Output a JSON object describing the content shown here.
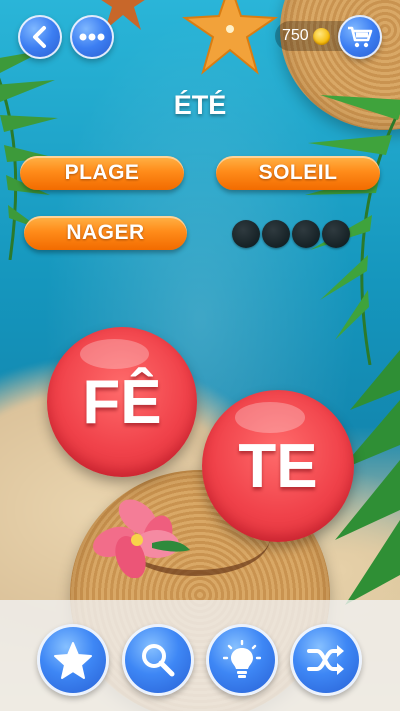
{
  "header": {
    "back_icon": "chevron-left-icon",
    "menu_icon": "more-dots-icon",
    "coins": "750",
    "coin_icon": "coin-icon",
    "cart_icon": "shopping-cart-icon"
  },
  "puzzle": {
    "category": "ÉTÉ",
    "found_words": [
      {
        "label": "PLAGE"
      },
      {
        "label": "SOLEIL"
      },
      {
        "label": "NAGER"
      }
    ],
    "hidden_word_letter_count": 4
  },
  "letter_bubbles": [
    {
      "label": "FÊ"
    },
    {
      "label": "TE"
    }
  ],
  "toolbar": {
    "items": [
      {
        "icon": "star-icon"
      },
      {
        "icon": "magnifier-icon"
      },
      {
        "icon": "lightbulb-icon"
      },
      {
        "icon": "shuffle-icon"
      }
    ]
  },
  "colors": {
    "pill_orange": "#ff8c1a",
    "bubble_red": "#f0424a",
    "button_blue": "#3c7ef2"
  }
}
